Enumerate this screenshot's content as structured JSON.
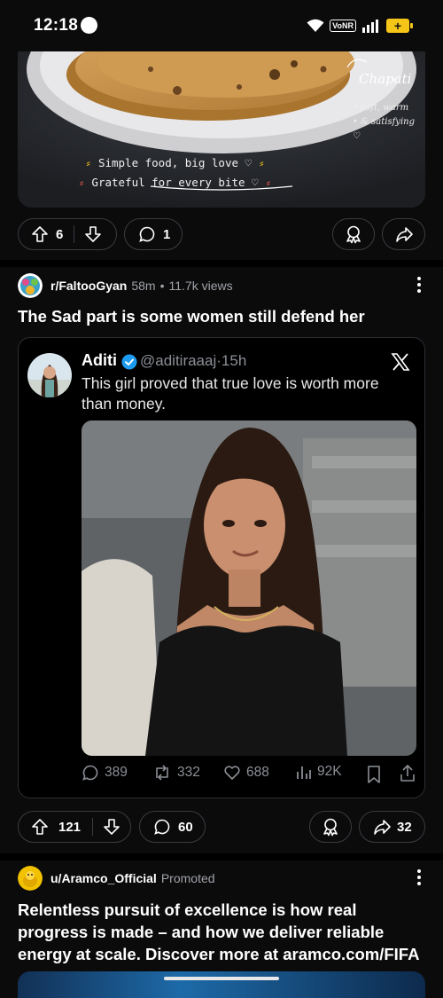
{
  "status_bar": {
    "time": "12:18",
    "volte": "VoNR"
  },
  "prev_post": {
    "image": {
      "label": "Chapati",
      "sublabel_1": "• soft, warm",
      "sublabel_2": "• & satisfying ♡",
      "caption_1": "Simple food, big love ♡",
      "caption_2": "Grateful for every bite ♡"
    },
    "upvotes": "6",
    "comments": "1"
  },
  "post": {
    "subreddit": "r/FaltooGyan",
    "age": "58m",
    "views": "11.7k views",
    "title": "The Sad part is some women still defend her",
    "tweet": {
      "name": "Aditi",
      "handle": "@aditiraaaj",
      "time": "15h",
      "text": "This girl proved that true love is worth more than money.",
      "replies": "389",
      "retweets": "332",
      "likes": "688",
      "views": "92K"
    },
    "upvotes": "121",
    "comments": "60",
    "shares": "32"
  },
  "promo_post": {
    "user": "u/Aramco_Official",
    "label": "Promoted",
    "title": "Relentless pursuit of excellence is how real progress is made – and how we deliver reliable energy at scale. Discover more at aramco.com/FIFA"
  },
  "colors": {
    "background": "#0b0b0c",
    "border": "#3a3c40",
    "meta": "#a0a3a8",
    "verified": "#1d9bf0"
  }
}
